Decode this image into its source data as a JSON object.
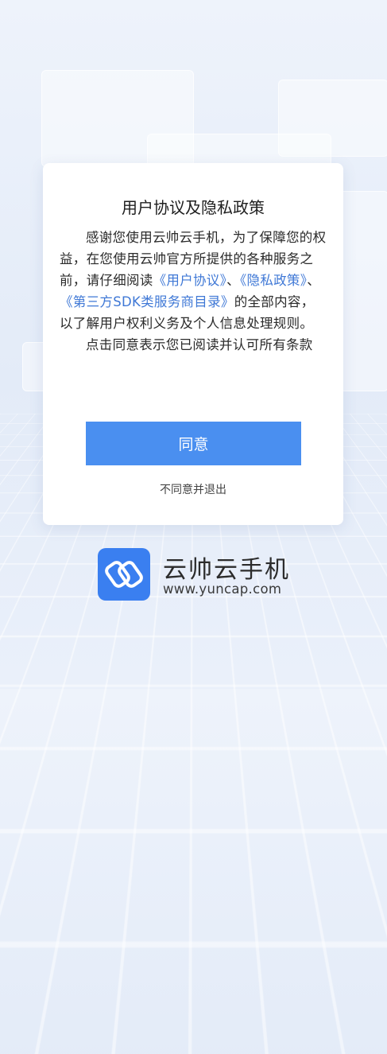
{
  "dialog": {
    "title": "用户协议及隐私政策",
    "p1_intro": "感谢您使用云帅云手机，为了保障您的权益，在您使用云帅官方所提供的各种服务之前，请仔细阅读",
    "link_user_agreement": "《用户协议》",
    "sep1": "、",
    "link_privacy_policy": "《隐私政策》",
    "sep2": "、",
    "link_third_party_sdk": "《第三方SDK类服务商目录》",
    "p1_tail": "的全部内容，以了解用户权利义务及个人信息处理规则。",
    "p2": "点击同意表示您已阅读并认可所有条款",
    "agree_label": "同意",
    "reject_label": "不同意并退出"
  },
  "brand": {
    "name": "云帅云手机",
    "url": "www.yuncap.com",
    "logo_icon": "linked-rings-icon",
    "logo_color": "#3a7ff0"
  },
  "colors": {
    "link": "#3f78d6",
    "button": "#4a8ff0"
  }
}
